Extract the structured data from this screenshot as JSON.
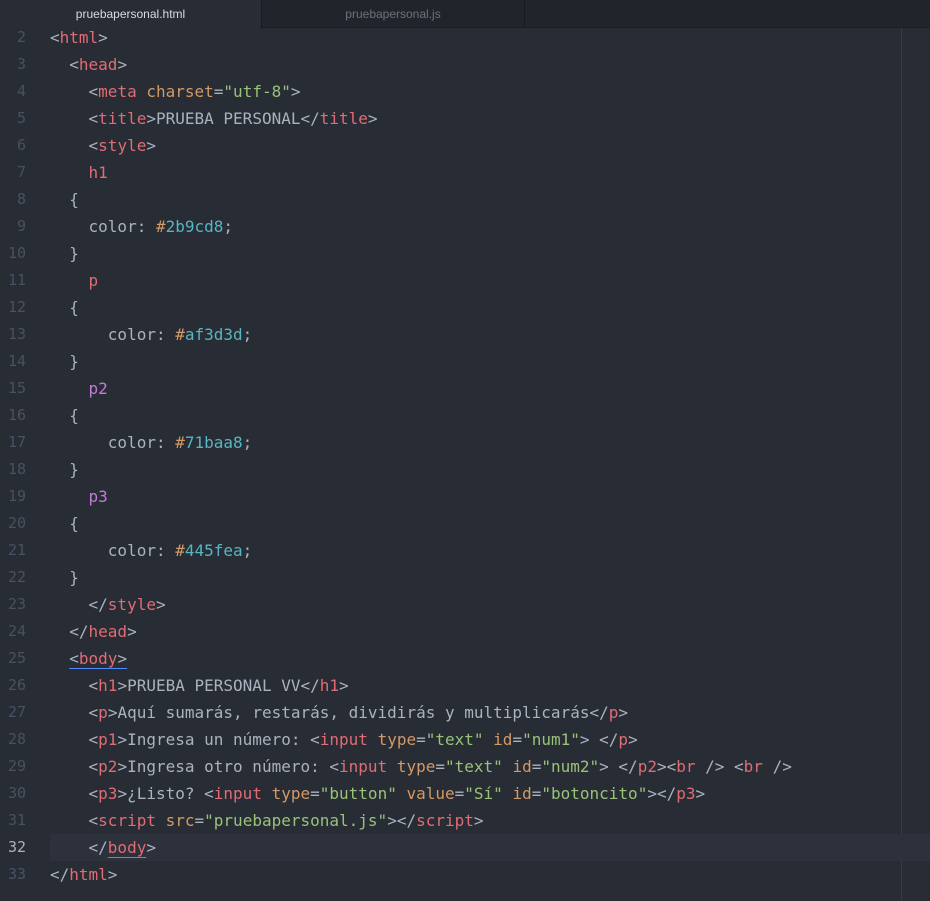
{
  "tabs": [
    {
      "label": "pruebapersonal.html",
      "active": true
    },
    {
      "label": "pruebapersonal.js",
      "active": false
    }
  ],
  "editor": {
    "current_line": 32,
    "lines": [
      {
        "n": "2",
        "tokens": [
          [
            "punct",
            "<"
          ],
          [
            "tag",
            "html"
          ],
          [
            "punct",
            ">"
          ]
        ]
      },
      {
        "n": "3",
        "tokens": [
          [
            "text",
            "  "
          ],
          [
            "punct",
            "<"
          ],
          [
            "tag",
            "head"
          ],
          [
            "punct",
            ">"
          ]
        ]
      },
      {
        "n": "4",
        "tokens": [
          [
            "text",
            "    "
          ],
          [
            "punct",
            "<"
          ],
          [
            "tag",
            "meta"
          ],
          [
            "text",
            " "
          ],
          [
            "attr",
            "charset"
          ],
          [
            "punct",
            "="
          ],
          [
            "str",
            "\"utf-8\""
          ],
          [
            "punct",
            ">"
          ]
        ]
      },
      {
        "n": "5",
        "tokens": [
          [
            "text",
            "    "
          ],
          [
            "punct",
            "<"
          ],
          [
            "tag",
            "title"
          ],
          [
            "punct",
            ">"
          ],
          [
            "text",
            "PRUEBA PERSONAL"
          ],
          [
            "punct",
            "</"
          ],
          [
            "tag",
            "title"
          ],
          [
            "punct",
            ">"
          ]
        ]
      },
      {
        "n": "6",
        "tokens": [
          [
            "text",
            "    "
          ],
          [
            "punct",
            "<"
          ],
          [
            "tag",
            "style"
          ],
          [
            "punct",
            ">"
          ]
        ]
      },
      {
        "n": "7",
        "tokens": [
          [
            "text",
            "    "
          ],
          [
            "sel1",
            "h1"
          ]
        ]
      },
      {
        "n": "8",
        "tokens": [
          [
            "text",
            "  "
          ],
          [
            "punct",
            "{"
          ]
        ]
      },
      {
        "n": "9",
        "tokens": [
          [
            "text",
            "    "
          ],
          [
            "prop",
            "color"
          ],
          [
            "punct",
            ": "
          ],
          [
            "hash",
            "#"
          ],
          [
            "hex",
            "2b9cd8"
          ],
          [
            "punct",
            ";"
          ]
        ]
      },
      {
        "n": "10",
        "tokens": [
          [
            "text",
            "  "
          ],
          [
            "punct",
            "}"
          ]
        ]
      },
      {
        "n": "11",
        "tokens": [
          [
            "text",
            "    "
          ],
          [
            "sel1",
            "p"
          ]
        ]
      },
      {
        "n": "12",
        "tokens": [
          [
            "text",
            "  "
          ],
          [
            "punct",
            "{"
          ]
        ]
      },
      {
        "n": "13",
        "tokens": [
          [
            "text",
            "      "
          ],
          [
            "prop",
            "color"
          ],
          [
            "punct",
            ": "
          ],
          [
            "hash",
            "#"
          ],
          [
            "hex",
            "af3d3d"
          ],
          [
            "punct",
            ";"
          ]
        ]
      },
      {
        "n": "14",
        "tokens": [
          [
            "text",
            "  "
          ],
          [
            "punct",
            "}"
          ]
        ]
      },
      {
        "n": "15",
        "tokens": [
          [
            "text",
            "    "
          ],
          [
            "sel2",
            "p2"
          ]
        ]
      },
      {
        "n": "16",
        "tokens": [
          [
            "text",
            "  "
          ],
          [
            "punct",
            "{"
          ]
        ]
      },
      {
        "n": "17",
        "tokens": [
          [
            "text",
            "      "
          ],
          [
            "prop",
            "color"
          ],
          [
            "punct",
            ": "
          ],
          [
            "hash",
            "#"
          ],
          [
            "hex",
            "71baa8"
          ],
          [
            "punct",
            ";"
          ]
        ]
      },
      {
        "n": "18",
        "tokens": [
          [
            "text",
            "  "
          ],
          [
            "punct",
            "}"
          ]
        ]
      },
      {
        "n": "19",
        "tokens": [
          [
            "text",
            "    "
          ],
          [
            "sel2",
            "p3"
          ]
        ]
      },
      {
        "n": "20",
        "tokens": [
          [
            "text",
            "  "
          ],
          [
            "punct",
            "{"
          ]
        ]
      },
      {
        "n": "21",
        "tokens": [
          [
            "text",
            "      "
          ],
          [
            "prop",
            "color"
          ],
          [
            "punct",
            ": "
          ],
          [
            "hash",
            "#"
          ],
          [
            "hex",
            "445fea"
          ],
          [
            "punct",
            ";"
          ]
        ]
      },
      {
        "n": "22",
        "tokens": [
          [
            "text",
            "  "
          ],
          [
            "punct",
            "}"
          ]
        ]
      },
      {
        "n": "23",
        "tokens": [
          [
            "text",
            "    "
          ],
          [
            "punct",
            "</"
          ],
          [
            "tag",
            "style"
          ],
          [
            "punct",
            ">"
          ]
        ]
      },
      {
        "n": "24",
        "tokens": [
          [
            "text",
            "  "
          ],
          [
            "punct",
            "</"
          ],
          [
            "tag",
            "head"
          ],
          [
            "punct",
            ">"
          ]
        ]
      },
      {
        "n": "25",
        "tokens": [
          [
            "text",
            "  "
          ],
          [
            "punctu",
            "<"
          ],
          [
            "tagu",
            "body"
          ],
          [
            "punctu",
            ">"
          ]
        ]
      },
      {
        "n": "26",
        "tokens": [
          [
            "text",
            "    "
          ],
          [
            "punct",
            "<"
          ],
          [
            "tag",
            "h1"
          ],
          [
            "punct",
            ">"
          ],
          [
            "text",
            "PRUEBA PERSONAL VV"
          ],
          [
            "punct",
            "</"
          ],
          [
            "tag",
            "h1"
          ],
          [
            "punct",
            ">"
          ]
        ]
      },
      {
        "n": "27",
        "tokens": [
          [
            "text",
            "    "
          ],
          [
            "punct",
            "<"
          ],
          [
            "tag",
            "p"
          ],
          [
            "punct",
            ">"
          ],
          [
            "text",
            "Aquí sumarás, restarás, dividirás y multiplicarás"
          ],
          [
            "punct",
            "</"
          ],
          [
            "tag",
            "p"
          ],
          [
            "punct",
            ">"
          ]
        ]
      },
      {
        "n": "28",
        "tokens": [
          [
            "text",
            "    "
          ],
          [
            "punct",
            "<"
          ],
          [
            "tag",
            "p1"
          ],
          [
            "punct",
            ">"
          ],
          [
            "text",
            "Ingresa un número: "
          ],
          [
            "punct",
            "<"
          ],
          [
            "tag",
            "input"
          ],
          [
            "text",
            " "
          ],
          [
            "attr",
            "type"
          ],
          [
            "punct",
            "="
          ],
          [
            "str",
            "\"text\""
          ],
          [
            "text",
            " "
          ],
          [
            "attr",
            "id"
          ],
          [
            "punct",
            "="
          ],
          [
            "str",
            "\"num1\""
          ],
          [
            "punct",
            ">"
          ],
          [
            "text",
            " "
          ],
          [
            "punct",
            "</"
          ],
          [
            "tag",
            "p"
          ],
          [
            "punct",
            ">"
          ]
        ]
      },
      {
        "n": "29",
        "tokens": [
          [
            "text",
            "    "
          ],
          [
            "punct",
            "<"
          ],
          [
            "tag",
            "p2"
          ],
          [
            "punct",
            ">"
          ],
          [
            "text",
            "Ingresa otro número: "
          ],
          [
            "punct",
            "<"
          ],
          [
            "tag",
            "input"
          ],
          [
            "text",
            " "
          ],
          [
            "attr",
            "type"
          ],
          [
            "punct",
            "="
          ],
          [
            "str",
            "\"text\""
          ],
          [
            "text",
            " "
          ],
          [
            "attr",
            "id"
          ],
          [
            "punct",
            "="
          ],
          [
            "str",
            "\"num2\""
          ],
          [
            "punct",
            ">"
          ],
          [
            "text",
            " "
          ],
          [
            "punct",
            "</"
          ],
          [
            "tag",
            "p2"
          ],
          [
            "punct",
            "><"
          ],
          [
            "tag",
            "br"
          ],
          [
            "text",
            " "
          ],
          [
            "punct",
            "/>"
          ],
          [
            "text",
            " "
          ],
          [
            "punct",
            "<"
          ],
          [
            "tag",
            "br"
          ],
          [
            "text",
            " "
          ],
          [
            "punct",
            "/>"
          ]
        ]
      },
      {
        "n": "30",
        "tokens": [
          [
            "text",
            "    "
          ],
          [
            "punct",
            "<"
          ],
          [
            "tag",
            "p3"
          ],
          [
            "punct",
            ">"
          ],
          [
            "text",
            "¿Listo? "
          ],
          [
            "punct",
            "<"
          ],
          [
            "tag",
            "input"
          ],
          [
            "text",
            " "
          ],
          [
            "attr",
            "type"
          ],
          [
            "punct",
            "="
          ],
          [
            "str",
            "\"button\""
          ],
          [
            "text",
            " "
          ],
          [
            "attr",
            "value"
          ],
          [
            "punct",
            "="
          ],
          [
            "str",
            "\"Sí\""
          ],
          [
            "text",
            " "
          ],
          [
            "attr",
            "id"
          ],
          [
            "punct",
            "="
          ],
          [
            "str",
            "\"botoncito\""
          ],
          [
            "punct",
            "></"
          ],
          [
            "tag",
            "p3"
          ],
          [
            "punct",
            ">"
          ]
        ]
      },
      {
        "n": "31",
        "tokens": [
          [
            "text",
            "    "
          ],
          [
            "punct",
            "<"
          ],
          [
            "tag",
            "script"
          ],
          [
            "text",
            " "
          ],
          [
            "attr",
            "src"
          ],
          [
            "punct",
            "="
          ],
          [
            "str",
            "\"pruebapersonal.js\""
          ],
          [
            "punct",
            "></"
          ],
          [
            "tag",
            "script"
          ],
          [
            "punct",
            ">"
          ]
        ]
      },
      {
        "n": "32",
        "tokens": [
          [
            "text",
            "    "
          ],
          [
            "punct",
            "</"
          ],
          [
            "tagu",
            "body"
          ],
          [
            "punct",
            ">"
          ]
        ]
      },
      {
        "n": "33",
        "tokens": [
          [
            "punct",
            "</"
          ],
          [
            "tag",
            "html"
          ],
          [
            "punct",
            ">"
          ]
        ]
      }
    ]
  }
}
